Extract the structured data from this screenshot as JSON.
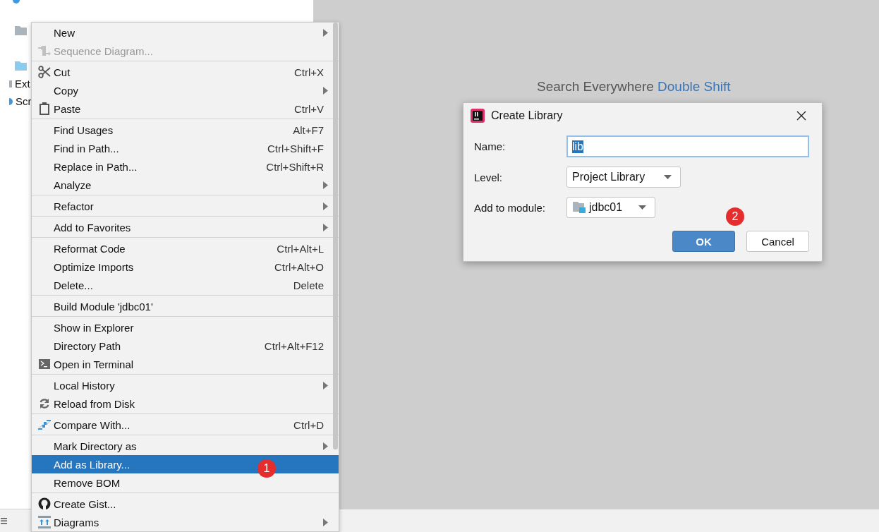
{
  "project_tree": {
    "rows": [
      {
        "kind": "dot"
      },
      {
        "kind": "module-folder"
      },
      {
        "kind": "folder"
      },
      {
        "kind": "library",
        "label": "Ext"
      },
      {
        "kind": "scratch",
        "label": "Scr"
      }
    ]
  },
  "editor_hint": {
    "text": "Search Everywhere",
    "shortcut": "Double Shift"
  },
  "context_menu": {
    "groups": [
      {
        "items": [
          {
            "label": "New",
            "submenu": true,
            "disabled": false,
            "selected": false
          },
          {
            "label": "Sequence Diagram...",
            "kind": "sequence",
            "submenu": false,
            "disabled": true,
            "selected": false
          }
        ]
      },
      {
        "items": [
          {
            "label": "Cut",
            "kind": "scissors",
            "shortcut": "Ctrl+X",
            "submenu": false,
            "disabled": false,
            "selected": false
          },
          {
            "label": "Copy",
            "submenu": true,
            "disabled": false,
            "selected": false
          },
          {
            "label": "Paste",
            "kind": "clipboard",
            "shortcut": "Ctrl+V",
            "submenu": false,
            "disabled": false,
            "selected": false
          }
        ]
      },
      {
        "items": [
          {
            "label": "Find Usages",
            "shortcut": "Alt+F7",
            "submenu": false,
            "disabled": false,
            "selected": false
          },
          {
            "label": "Find in Path...",
            "shortcut": "Ctrl+Shift+F",
            "submenu": false,
            "disabled": false,
            "selected": false
          },
          {
            "label": "Replace in Path...",
            "shortcut": "Ctrl+Shift+R",
            "submenu": false,
            "disabled": false,
            "selected": false
          },
          {
            "label": "Analyze",
            "submenu": true,
            "disabled": false,
            "selected": false
          }
        ]
      },
      {
        "items": [
          {
            "label": "Refactor",
            "submenu": true,
            "disabled": false,
            "selected": false
          }
        ]
      },
      {
        "items": [
          {
            "label": "Add to Favorites",
            "submenu": true,
            "disabled": false,
            "selected": false
          }
        ]
      },
      {
        "items": [
          {
            "label": "Reformat Code",
            "shortcut": "Ctrl+Alt+L",
            "submenu": false,
            "disabled": false,
            "selected": false
          },
          {
            "label": "Optimize Imports",
            "shortcut": "Ctrl+Alt+O",
            "submenu": false,
            "disabled": false,
            "selected": false
          },
          {
            "label": "Delete...",
            "shortcut": "Delete",
            "submenu": false,
            "disabled": false,
            "selected": false
          }
        ]
      },
      {
        "items": [
          {
            "label": "Build Module 'jdbc01'",
            "submenu": false,
            "disabled": false,
            "selected": false
          }
        ]
      },
      {
        "items": [
          {
            "label": "Show in Explorer",
            "submenu": false,
            "disabled": false,
            "selected": false
          },
          {
            "label": "Directory Path",
            "shortcut": "Ctrl+Alt+F12",
            "submenu": false,
            "disabled": false,
            "selected": false
          },
          {
            "label": "Open in Terminal",
            "kind": "terminal",
            "submenu": false,
            "disabled": false,
            "selected": false
          }
        ]
      },
      {
        "items": [
          {
            "label": "Local History",
            "submenu": true,
            "disabled": false,
            "selected": false
          },
          {
            "label": "Reload from Disk",
            "kind": "reload",
            "submenu": false,
            "disabled": false,
            "selected": false
          }
        ]
      },
      {
        "items": [
          {
            "label": "Compare With...",
            "kind": "compare",
            "shortcut": "Ctrl+D",
            "submenu": false,
            "disabled": false,
            "selected": false
          }
        ]
      },
      {
        "items": [
          {
            "label": "Mark Directory as",
            "submenu": true,
            "disabled": false,
            "selected": false
          },
          {
            "label": "Add as Library...",
            "submenu": false,
            "disabled": false,
            "selected": true,
            "badge": "1"
          },
          {
            "label": "Remove BOM",
            "submenu": false,
            "disabled": false,
            "selected": false
          }
        ]
      },
      {
        "items": [
          {
            "label": "Create Gist...",
            "kind": "gist",
            "submenu": false,
            "disabled": false,
            "selected": false
          },
          {
            "label": "Diagrams",
            "kind": "diagram",
            "submenu": true,
            "disabled": false,
            "selected": false
          }
        ]
      }
    ]
  },
  "dialog": {
    "title": "Create Library",
    "badge": "2",
    "fields": [
      {
        "kind": "text",
        "label": "Name:",
        "value": "lib",
        "value_highlighted": true
      },
      {
        "kind": "dropdown",
        "label": "Level:",
        "value": "Project Library",
        "value_highlighted": false
      },
      {
        "kind": "module-dropdown",
        "label": "Add to module:",
        "value": "jdbc01",
        "value_highlighted": false
      }
    ],
    "buttons": [
      {
        "label": "OK",
        "default": true
      },
      {
        "label": "Cancel",
        "default": false
      }
    ]
  }
}
